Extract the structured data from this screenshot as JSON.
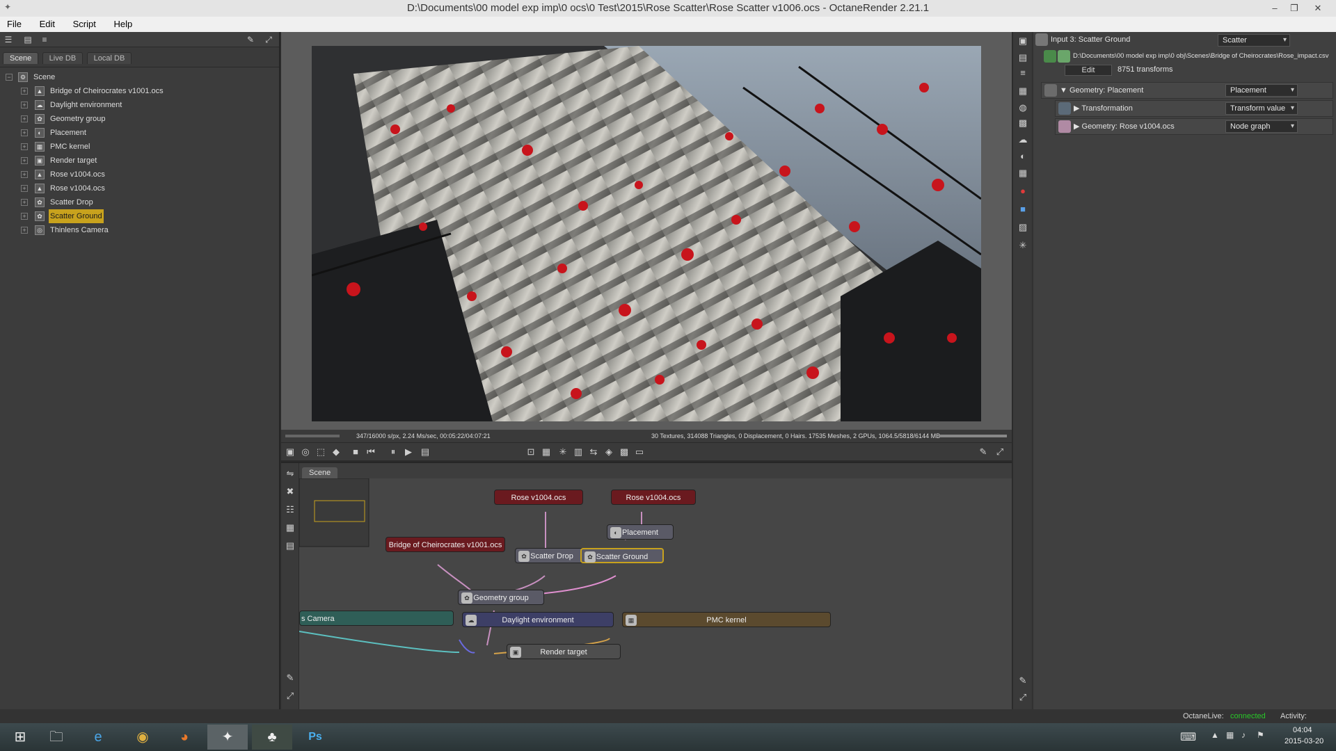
{
  "window": {
    "title": "D:\\Documents\\00 model exp imp\\0 ocs\\0 Test\\2015\\Rose Scatter\\Rose Scatter v1006.ocs - OctaneRender 2.21.1"
  },
  "menu": [
    "File",
    "Edit",
    "Script",
    "Help"
  ],
  "left_panel": {
    "tabs": [
      "Scene",
      "Live DB",
      "Local DB"
    ],
    "root": "Scene",
    "items": [
      {
        "label": "Bridge of Cheirocrates v1001.ocs",
        "icon": "mesh-icon"
      },
      {
        "label": "Daylight environment",
        "icon": "environment-icon"
      },
      {
        "label": "Geometry group",
        "icon": "group-icon"
      },
      {
        "label": "Placement",
        "icon": "placement-icon"
      },
      {
        "label": "PMC kernel",
        "icon": "kernel-icon"
      },
      {
        "label": "Render target",
        "icon": "render-target-icon"
      },
      {
        "label": "Rose v1004.ocs",
        "icon": "mesh-icon"
      },
      {
        "label": "Rose v1004.ocs",
        "icon": "mesh-icon"
      },
      {
        "label": "Scatter Drop",
        "icon": "scatter-icon"
      },
      {
        "label": "Scatter Ground",
        "icon": "scatter-icon",
        "selected": true
      },
      {
        "label": "Thinlens Camera",
        "icon": "camera-icon"
      }
    ]
  },
  "render_status": {
    "left": "347/16000 s/px, 2.24 Ms/sec, 00:05:22/04:07:21",
    "right": "30 Textures, 314088 Triangles, 0 Displacement, 0 Hairs. 17535 Meshes, 2 GPUs, 1064.5/5818/6144 MB"
  },
  "graph": {
    "tab": "Scene",
    "nodes": {
      "rose1": "Rose v1004.ocs",
      "rose2": "Rose v1004.ocs",
      "placement": "Placement",
      "bridge": "Bridge of Cheirocrates v1001.ocs",
      "scatter_drop": "Scatter Drop",
      "scatter_ground": "Scatter Ground",
      "geometry_group": "Geometry group",
      "camera": "s Camera",
      "daylight": "Daylight environment",
      "pmc": "PMC kernel",
      "render_target": "Render target"
    }
  },
  "inspector": {
    "header_label": "Input 3: Scatter Ground",
    "header_dropdown": "Scatter",
    "file_path": "D:\\Documents\\00 model exp imp\\0 obj\\Scenes\\Bridge of Cheirocrates\\Rose_impact.csv",
    "edit_button": "Edit",
    "transforms": "8751 transforms",
    "geometry_row": {
      "label": "Geometry: Placement",
      "dropdown": "Placement"
    },
    "transformation_row": {
      "label": "Transformation",
      "dropdown": "Transform value"
    },
    "geometry_rose_row": {
      "label": "Geometry: Rose v1004.ocs",
      "dropdown": "Node graph"
    }
  },
  "status_bottom": {
    "octanelive_label": "OctaneLive:",
    "octanelive_value": "connected",
    "activity_label": "Activity:"
  },
  "taskbar": {
    "time": "04:04",
    "date": "2015-03-20"
  },
  "colors": {
    "selected": "#c8a21d",
    "connected": "#28c828",
    "rose_node": "#6a1a1f",
    "scatter_node": "#5a5a66",
    "daylight_node": "#3d3f66",
    "camera_node": "#2f5e57",
    "pmc_node": "#5b4a2e"
  }
}
